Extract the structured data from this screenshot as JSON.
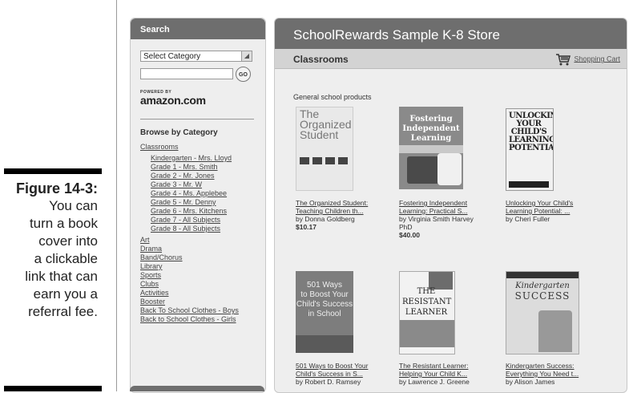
{
  "caption": {
    "figure": "Figure 14-3:",
    "lines": [
      "You can",
      "turn a book",
      "cover into",
      "a clickable",
      "link that can",
      "earn you a",
      "referral fee."
    ]
  },
  "sidebar": {
    "search_title": "Search",
    "category_select": "Select Category",
    "go_label": "GO",
    "powered_by": "POWERED BY",
    "amazon_logo": "amazon.com",
    "browse_heading": "Browse by Category",
    "categories": [
      {
        "label": "Classrooms",
        "sub": false
      },
      {
        "label": "Kindergarten - Mrs. Lloyd",
        "sub": true
      },
      {
        "label": "Grade 1 - Mrs. Smith",
        "sub": true
      },
      {
        "label": "Grade 2 - Mr. Jones",
        "sub": true
      },
      {
        "label": "Grade 3 - Mr. W",
        "sub": true
      },
      {
        "label": "Grade 4 - Ms. Applebee",
        "sub": true
      },
      {
        "label": "Grade 5 - Mr. Denny",
        "sub": true
      },
      {
        "label": "Grade 6 - Mrs. Kitchens",
        "sub": true
      },
      {
        "label": "Grade 7 - All Subjects",
        "sub": true
      },
      {
        "label": "Grade 8 - All Subjects",
        "sub": true
      },
      {
        "label": "Art",
        "sub": false
      },
      {
        "label": "Drama",
        "sub": false
      },
      {
        "label": "Band/Chorus",
        "sub": false
      },
      {
        "label": "Library",
        "sub": false
      },
      {
        "label": "Sports",
        "sub": false
      },
      {
        "label": "Clubs",
        "sub": false
      },
      {
        "label": "Activities",
        "sub": false
      },
      {
        "label": "Booster",
        "sub": false
      },
      {
        "label": "Back To School Clothes - Boys",
        "sub": false
      },
      {
        "label": "Back to School Clothes - Girls",
        "sub": false
      }
    ]
  },
  "store": {
    "title": "SchoolRewards Sample K-8 Store",
    "section": "Classrooms",
    "cart_label": "Shopping Cart",
    "subheading": "General school products",
    "products": [
      {
        "title": "The Organized Student: Teaching Children th...",
        "line1": "The Organized Student:",
        "line2": "Teaching Children th...",
        "author": "by Donna Goldberg",
        "author2": "",
        "price": "$10.17",
        "cover_text": [
          "The",
          "Organized",
          "Student"
        ]
      },
      {
        "title": "Fostering Independent Learning: Practical S...",
        "line1": "Fostering Independent",
        "line2": "Learning: Practical S...",
        "author": "by Virginia Smith Harvey",
        "author2": "PhD",
        "price": "$40.00",
        "cover_text": [
          "Fostering",
          "Independent",
          "Learning"
        ]
      },
      {
        "title": "Unlocking Your Child's Learning Potential: ...",
        "line1": "Unlocking Your Child's",
        "line2": "Learning Potential: ...",
        "author": "by Cheri Fuller",
        "author2": "",
        "price": "",
        "cover_text": [
          "UNLOCKING",
          "YOUR CHILD'S",
          "LEARNING",
          "POTENTIAL"
        ]
      },
      {
        "title": "501 Ways to Boost Your Child's Success in S...",
        "line1": "501 Ways to Boost Your",
        "line2": "Child's Success in S...",
        "author": "by Robert D. Ramsey",
        "author2": "",
        "price": "",
        "cover_text": [
          "501 Ways",
          "to Boost Your",
          "Child's Success",
          "in School"
        ]
      },
      {
        "title": "The Resistant Learner: Helping Your Child K...",
        "line1": "The Resistant Learner:",
        "line2": "Helping Your Child K...",
        "author": "by Lawrence J. Greene",
        "author2": "",
        "price": "",
        "cover_text": [
          "THE",
          "RESISTANT",
          "LEARNER"
        ]
      },
      {
        "title": "Kindergarten Success: Everything You Need t...",
        "line1": "Kindergarten Success:",
        "line2": "Everything You Need t...",
        "author": "by Alison James",
        "author2": "",
        "price": "",
        "cover_text": [
          "Kindergarten",
          "SUCCESS"
        ]
      }
    ]
  }
}
